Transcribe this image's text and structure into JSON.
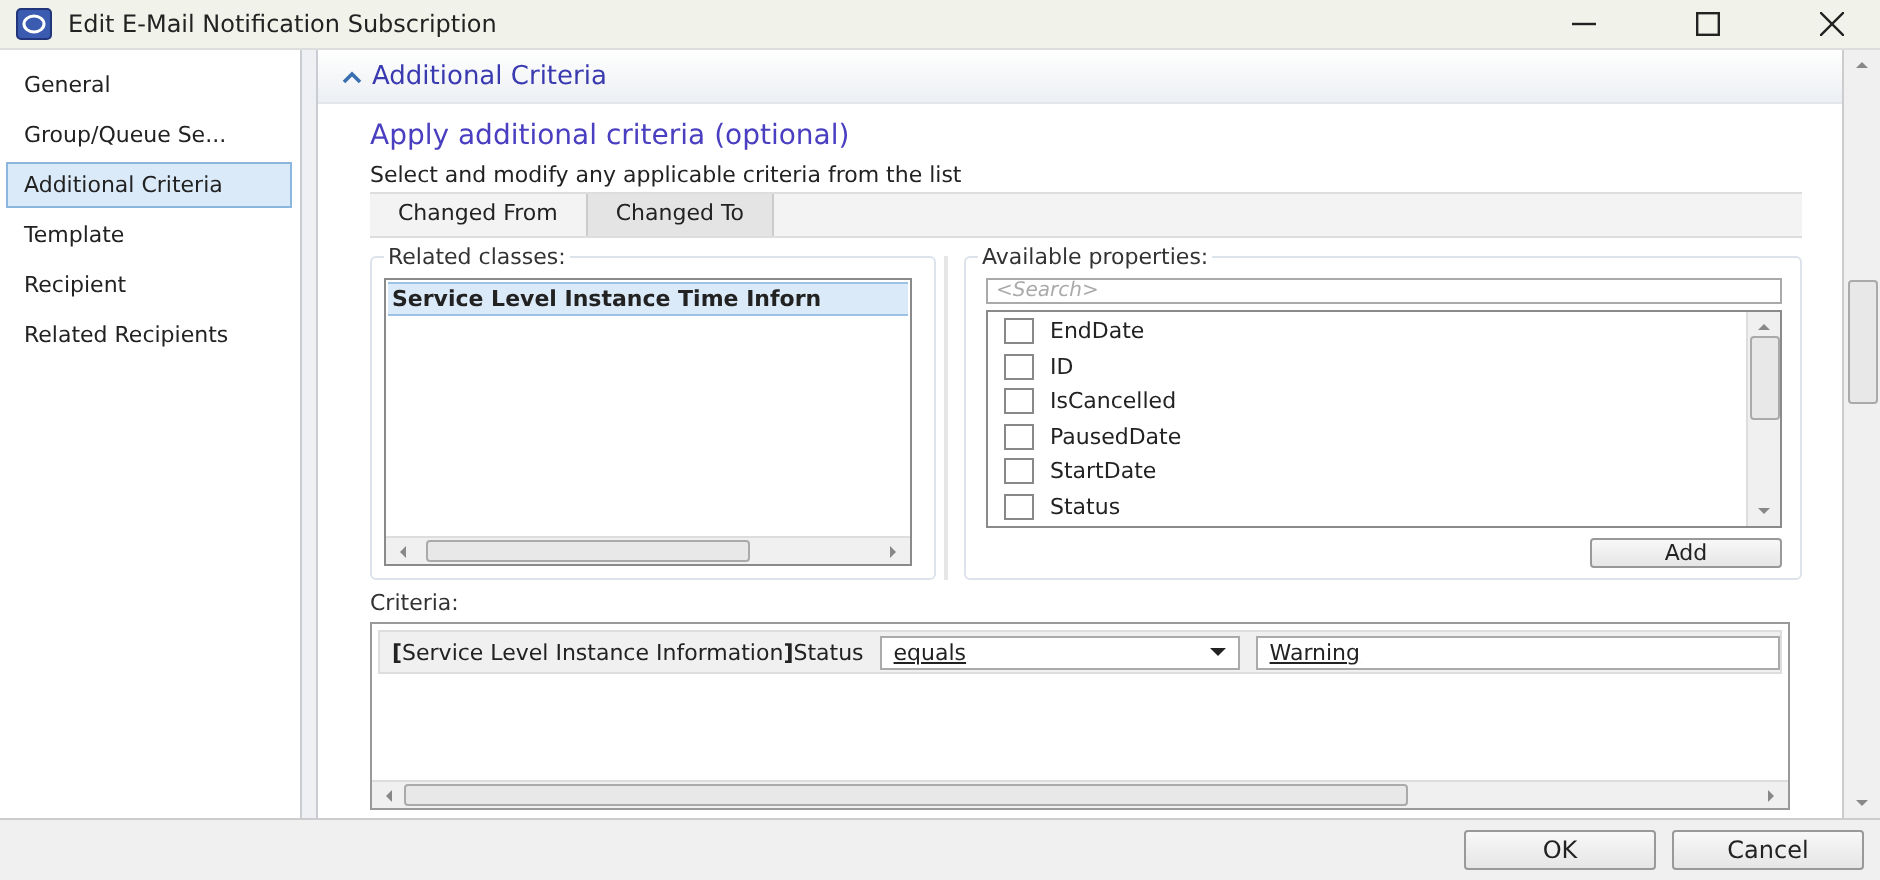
{
  "window": {
    "title": "Edit E-Mail Notification Subscription"
  },
  "sidebar": {
    "items": [
      {
        "label": "General",
        "selected": false
      },
      {
        "label": "Group/Queue Se...",
        "selected": false
      },
      {
        "label": "Additional Criteria",
        "selected": true
      },
      {
        "label": "Template",
        "selected": false
      },
      {
        "label": "Recipient",
        "selected": false
      },
      {
        "label": "Related Recipients",
        "selected": false
      }
    ]
  },
  "section": {
    "title": "Additional Criteria",
    "expanded": true
  },
  "heading": "Apply additional criteria (optional)",
  "description": "Select and modify any applicable criteria from the list",
  "tabs": [
    {
      "label": "Changed From",
      "selected": false
    },
    {
      "label": "Changed To",
      "selected": true
    }
  ],
  "related_classes": {
    "label": "Related classes:",
    "items": [
      {
        "label": "Service Level Instance Time Inforn",
        "selected": true
      }
    ]
  },
  "available_properties": {
    "label": "Available properties:",
    "search": {
      "placeholder": "<Search>"
    },
    "items": [
      {
        "label": "EndDate",
        "checked": false
      },
      {
        "label": "ID",
        "checked": false
      },
      {
        "label": "IsCancelled",
        "checked": false
      },
      {
        "label": "PausedDate",
        "checked": false
      },
      {
        "label": "StartDate",
        "checked": false
      },
      {
        "label": "Status",
        "checked": false
      }
    ],
    "add_button": "Add"
  },
  "criteria": {
    "label": "Criteria:",
    "rows": [
      {
        "property": "**[**Service Level Instance Information**]**Status",
        "operator": "equals",
        "value": "Warning"
      }
    ]
  },
  "buttons": [
    "OK",
    "Cancel"
  ]
}
